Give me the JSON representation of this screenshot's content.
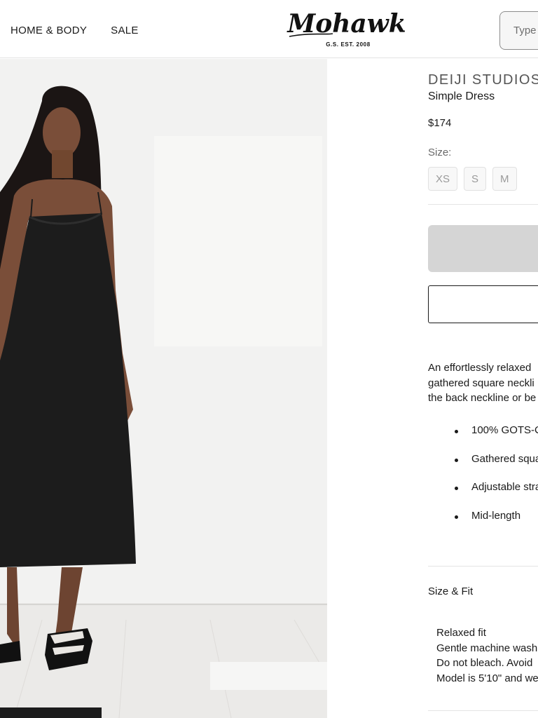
{
  "nav": {
    "items": [
      {
        "label": "HOME & BODY"
      },
      {
        "label": "SALE"
      }
    ]
  },
  "logo": {
    "text": "Mohawk",
    "sub": "G.S. EST. 2008"
  },
  "search": {
    "placeholder": "Type"
  },
  "product": {
    "brand": "DEIJI STUDIOS",
    "title": "Simple Dress",
    "price": "$174",
    "size_label": "Size:",
    "sizes": [
      "XS",
      "S",
      "M"
    ],
    "description": [
      "An effortlessly relaxed",
      "gathered square neckli",
      "the back neckline or be"
    ],
    "features": [
      "100% GOTS-C",
      "Gathered squa",
      "Adjustable stra",
      "Mid-length"
    ],
    "size_fit": {
      "heading": "Size & Fit",
      "lines": [
        "Relaxed fit",
        "Gentle machine wash",
        "Do not bleach. Avoid",
        "Model is 5'10\" and we"
      ]
    }
  },
  "colors": {
    "add_button_bg": "#d5d5d5",
    "size_button_bg": "#f8f8f8",
    "dress": "#1c1c1c",
    "photo_background": "#f1f1f0"
  },
  "icons": {
    "logo": "mohawk-script-logo"
  }
}
